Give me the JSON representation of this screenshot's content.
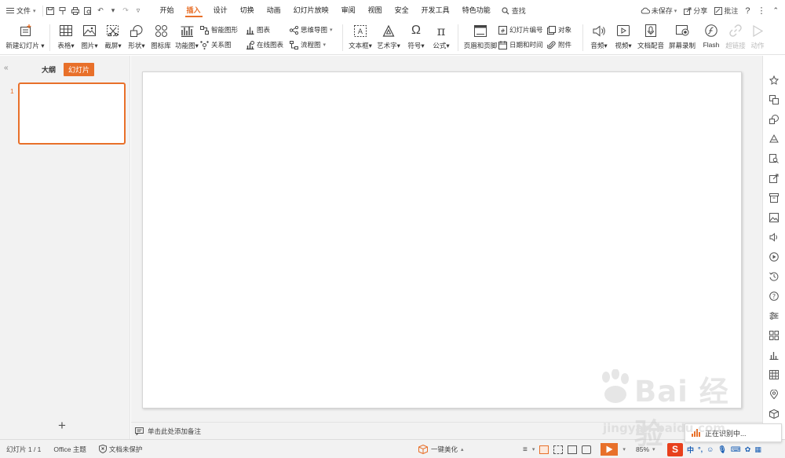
{
  "menubar": {
    "file_label": "文件",
    "tabs": [
      {
        "label": "开始"
      },
      {
        "label": "插入"
      },
      {
        "label": "设计"
      },
      {
        "label": "切换"
      },
      {
        "label": "动画"
      },
      {
        "label": "幻灯片放映"
      },
      {
        "label": "审阅"
      },
      {
        "label": "视图"
      },
      {
        "label": "安全"
      },
      {
        "label": "开发工具"
      },
      {
        "label": "特色功能"
      }
    ],
    "active_tab": "插入",
    "search_label": "查找",
    "unsaved_label": "未保存",
    "share_label": "分享",
    "comment_label": "批注"
  },
  "ribbon": {
    "new_slide": "新建幻灯片",
    "table": "表格",
    "picture": "图片",
    "screenshot": "截屏",
    "shape": "形状",
    "icon_lib": "图标库",
    "func_chart": "功能图",
    "smart_graphic": "智能图形",
    "relation_chart": "关系图",
    "chart": "图表",
    "online_chart": "在线图表",
    "mind_map": "思维导图",
    "flow_chart": "流程图",
    "textbox": "文本框",
    "art_text": "艺术字",
    "symbol": "符号",
    "formula": "公式",
    "header_footer": "页眉和页脚",
    "slide_number": "幻灯片编号",
    "date_time": "日期和时间",
    "object": "对象",
    "attachment": "附件",
    "audio": "音频",
    "video": "视频",
    "doc_dub": "文档配音",
    "screen_record": "屏幕录制",
    "flash": "Flash",
    "hyperlink": "超链接",
    "action": "动作"
  },
  "leftpanel": {
    "outline_tab": "大纲",
    "slides_tab": "幻灯片",
    "slide_number": "1",
    "add_icon": "+"
  },
  "notes": {
    "placeholder": "单击此处添加备注"
  },
  "statusbar": {
    "slide_info": "幻灯片 1 / 1",
    "theme": "Office 主题",
    "protection": "文档未保护",
    "beautify": "一键美化",
    "zoom": "85%",
    "ime_lang": "中"
  },
  "toast": {
    "text": "正在识别中..."
  },
  "watermark": {
    "brand": "Bai 经验",
    "url": "jingyan.baidu.com"
  },
  "colors": {
    "accent": "#e8702a",
    "sogou": "#e8401c",
    "panel_bg": "#f2f2f2"
  }
}
